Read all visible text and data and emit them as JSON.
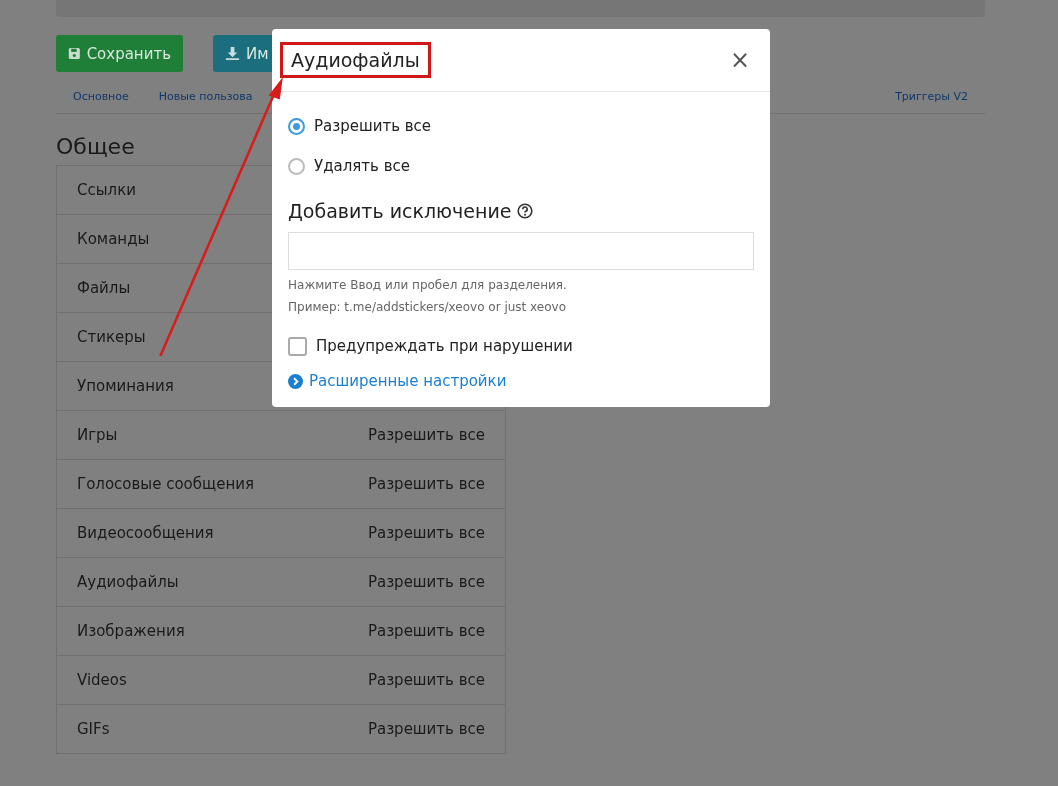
{
  "toolbar": {
    "buttons": [
      {
        "kind": "save",
        "label": "Сохранить"
      },
      {
        "kind": "import",
        "label": "Им"
      }
    ]
  },
  "tabs": [
    {
      "label": "Основное",
      "selected": false
    },
    {
      "label": "Новые пользова",
      "selected": false
    },
    {
      "label": "Триггеры V2",
      "selected": false
    }
  ],
  "section": {
    "title": "Общее",
    "rows": [
      {
        "name": "Ссылки"
      },
      {
        "name": "Команды"
      },
      {
        "name": "Файлы"
      },
      {
        "name": "Стикеры"
      },
      {
        "name": "Упоминания"
      },
      {
        "name": "Игры",
        "value": "Разрешить все"
      },
      {
        "name": "Голосовые сообщения",
        "value": "Разрешить все"
      },
      {
        "name": "Видеосообщения",
        "value": "Разрешить все"
      },
      {
        "name": "Аудиофайлы",
        "value": "Разрешить все"
      },
      {
        "name": "Изображения",
        "value": "Разрешить все"
      },
      {
        "name": "Videos",
        "value": "Разрешить все"
      },
      {
        "name": "GIFs",
        "value": "Разрешить все"
      }
    ]
  },
  "modal": {
    "title": "Аудиофайлы",
    "close": "×",
    "options": [
      {
        "label": "Разрешить все",
        "selected": true
      },
      {
        "label": "Удалять все",
        "selected": false
      }
    ],
    "exception": {
      "heading": "Добавить исключение",
      "hints": [
        "Нажмите Ввод или пробел для разделения.",
        "Пример: t.me/addstickers/xeovo or just xeovo"
      ]
    },
    "warn": {
      "label": "Предупреждать при нарушении",
      "checked": false
    },
    "advanced": {
      "label": "Расширенные настройки",
      "expanded": false
    }
  }
}
